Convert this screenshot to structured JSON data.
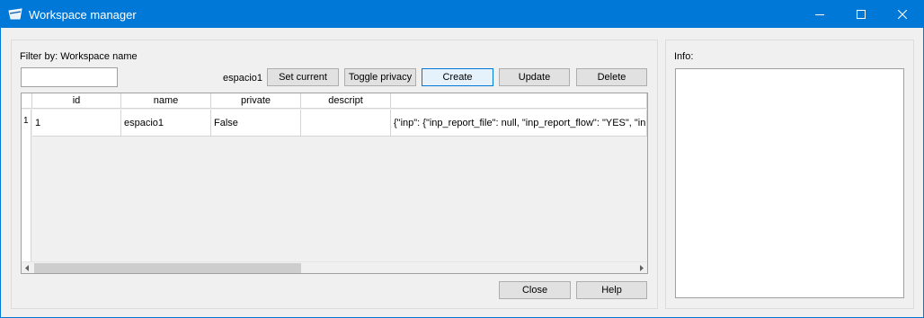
{
  "window": {
    "title": "Workspace manager"
  },
  "filter": {
    "label": "Filter by: Workspace name",
    "value": ""
  },
  "current_workspace": "espacio1",
  "toolbar": {
    "set_current": "Set current",
    "toggle_privacy": "Toggle privacy",
    "create": "Create",
    "update": "Update",
    "delete": "Delete"
  },
  "table": {
    "columns": [
      "id",
      "name",
      "private",
      "descript",
      ""
    ],
    "rows": [
      {
        "row_number": "1",
        "id": "1",
        "name": "espacio1",
        "private": "False",
        "descript": "",
        "config": "{\"inp\": {\"inp_report_file\": null, \"inp_report_flow\": \"YES\", \"inp_report_energy\": \"NO\""
      }
    ]
  },
  "footer": {
    "close": "Close",
    "help": "Help"
  },
  "info": {
    "label": "Info:",
    "text": ""
  },
  "colors": {
    "titlebar": "#0078d7",
    "focus_border": "#0078d7"
  }
}
